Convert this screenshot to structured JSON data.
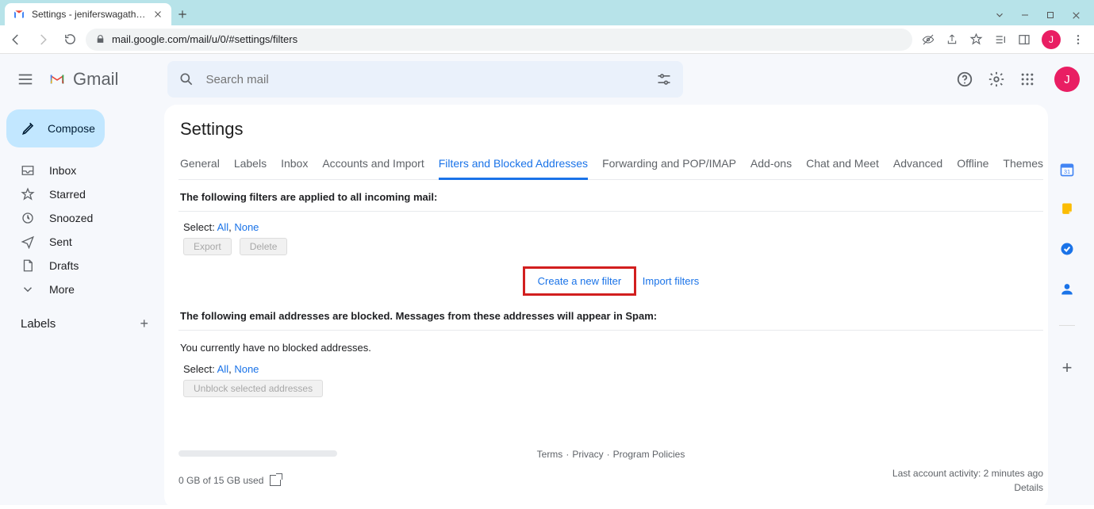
{
  "browser": {
    "tab_title": "Settings - jeniferswagathdj@gma",
    "url": "mail.google.com/mail/u/0/#settings/filters",
    "avatar_letter": "J"
  },
  "gmail": {
    "logo_text": "Gmail",
    "search_placeholder": "Search mail",
    "compose_label": "Compose",
    "avatar_letter": "J",
    "sidebar": {
      "items": [
        {
          "label": "Inbox"
        },
        {
          "label": "Starred"
        },
        {
          "label": "Snoozed"
        },
        {
          "label": "Sent"
        },
        {
          "label": "Drafts"
        },
        {
          "label": "More"
        }
      ],
      "labels_header": "Labels"
    },
    "settings": {
      "title": "Settings",
      "tabs": [
        {
          "label": "General"
        },
        {
          "label": "Labels"
        },
        {
          "label": "Inbox"
        },
        {
          "label": "Accounts and Import"
        },
        {
          "label": "Filters and Blocked Addresses",
          "active": true
        },
        {
          "label": "Forwarding and POP/IMAP"
        },
        {
          "label": "Add-ons"
        },
        {
          "label": "Chat and Meet"
        },
        {
          "label": "Advanced"
        },
        {
          "label": "Offline"
        },
        {
          "label": "Themes"
        }
      ],
      "filters_applied_text": "The following filters are applied to all incoming mail:",
      "select_label": "Select: ",
      "select_all": "All",
      "select_none": "None",
      "export_btn": "Export",
      "delete_btn": "Delete",
      "create_filter": "Create a new filter",
      "import_filters": "Import filters",
      "blocked_header": "The following email addresses are blocked. Messages from these addresses will appear in Spam:",
      "no_blocked_text": "You currently have no blocked addresses.",
      "unblock_btn": "Unblock selected addresses"
    },
    "footer": {
      "storage": "0 GB of 15 GB used",
      "terms": "Terms",
      "privacy": "Privacy",
      "program_policies": "Program Policies",
      "activity": "Last account activity: 2 minutes ago",
      "details": "Details"
    }
  }
}
